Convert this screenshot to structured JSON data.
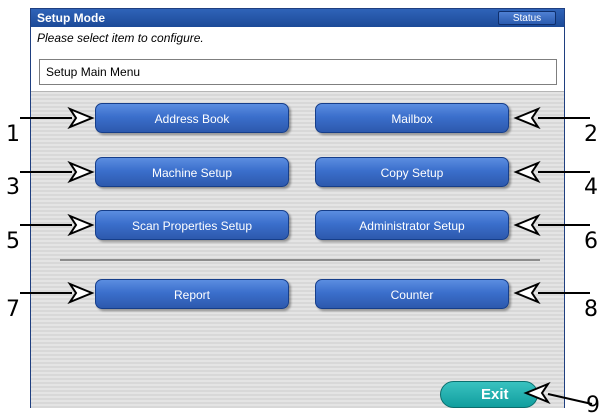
{
  "header": {
    "title": "Setup Mode",
    "status_label": "Status",
    "subtitle": "Please select item to configure."
  },
  "menu_field": {
    "value": "Setup Main Menu"
  },
  "buttons": {
    "address_book": "Address Book",
    "mailbox": "Mailbox",
    "machine_setup": "Machine Setup",
    "copy_setup": "Copy Setup",
    "scan_properties_setup": "Scan Properties Setup",
    "administrator_setup": "Administrator Setup",
    "report": "Report",
    "counter": "Counter",
    "exit": "Exit"
  },
  "callouts": [
    "1",
    "2",
    "3",
    "4",
    "5",
    "6",
    "7",
    "8",
    "9"
  ],
  "colors": {
    "title_bar": "#2f63b8",
    "button_blue": "#3b6fcc",
    "exit_teal": "#1aa9a8"
  }
}
